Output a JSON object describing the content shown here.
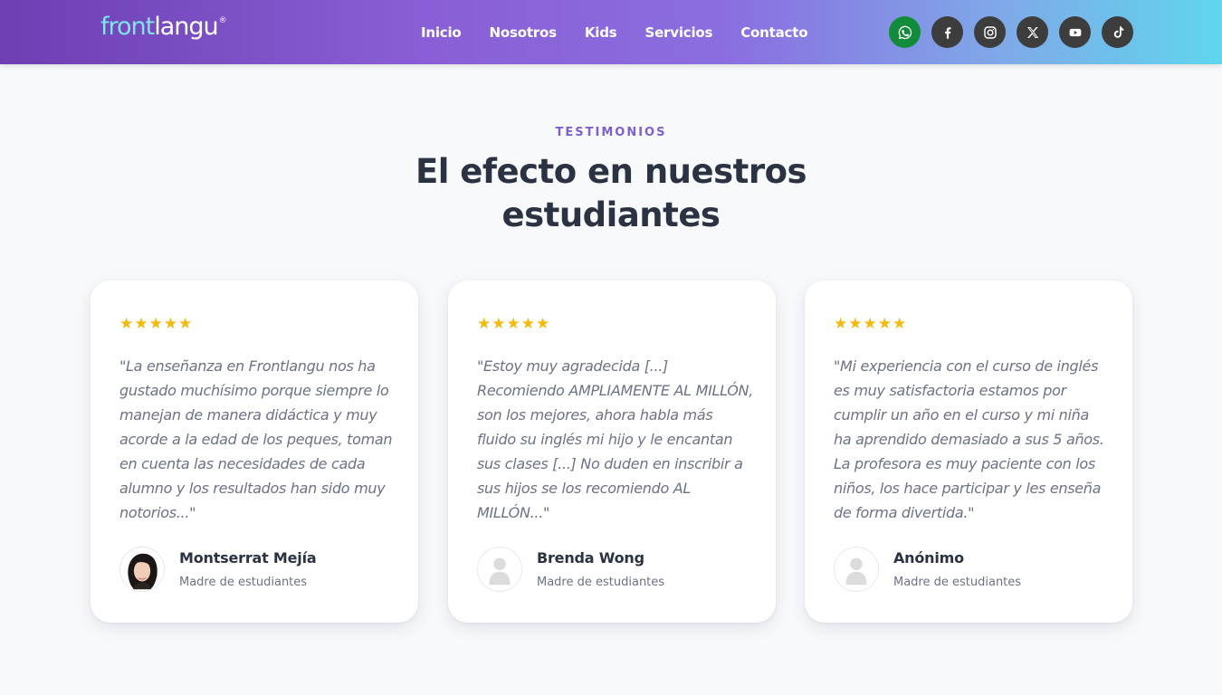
{
  "header": {
    "logo": {
      "part1": "front",
      "part2": "langu",
      "reg": "®"
    },
    "nav": [
      "Inicio",
      "Nosotros",
      "Kids",
      "Servicios",
      "Contacto"
    ],
    "social": [
      "whatsapp-icon",
      "facebook-icon",
      "instagram-icon",
      "x-icon",
      "youtube-icon",
      "tiktok-icon"
    ],
    "colors": {
      "gradient_start": "#6e3fb3",
      "gradient_end": "#5fd6ee",
      "whatsapp": "#128c3a"
    }
  },
  "section": {
    "eyebrow": "TESTIMONIOS",
    "title": "El efecto en nuestros estudiantes"
  },
  "testimonials": [
    {
      "stars": "★★★★★",
      "rating": 5,
      "quote": "\"La enseñanza en Frontlangu nos ha gustado muchísimo porque siempre lo manejan de manera didáctica y muy acorde a la edad de los peques, toman en cuenta las necesidades de cada alumno y los resultados han sido muy notorios...\"",
      "author": "Montserrat Mejía",
      "role": "Madre de estudiantes",
      "avatar": "photo"
    },
    {
      "stars": "★★★★★",
      "rating": 5,
      "quote": "\"Estoy muy agradecida [...] Recomiendo AMPLIAMENTE AL MILLÓN, son los mejores, ahora habla más fluido su inglés mi hijo y le encantan sus clases [...] No duden en inscribir a sus hijos se los recomiendo AL MILLÓN...\"",
      "author": "Brenda Wong",
      "role": "Madre de estudiantes",
      "avatar": "placeholder"
    },
    {
      "stars": "★★★★★",
      "rating": 5,
      "quote": "\"Mi experiencia con el curso de inglés es muy satisfactoria estamos por cumplir un año en el curso y mi niña ha aprendido demasiado a sus 5 años. La profesora es muy paciente con los niños, los hace participar y les enseña de forma divertida.\"",
      "author": "Anónimo",
      "role": "Madre de estudiantes",
      "avatar": "placeholder"
    }
  ]
}
